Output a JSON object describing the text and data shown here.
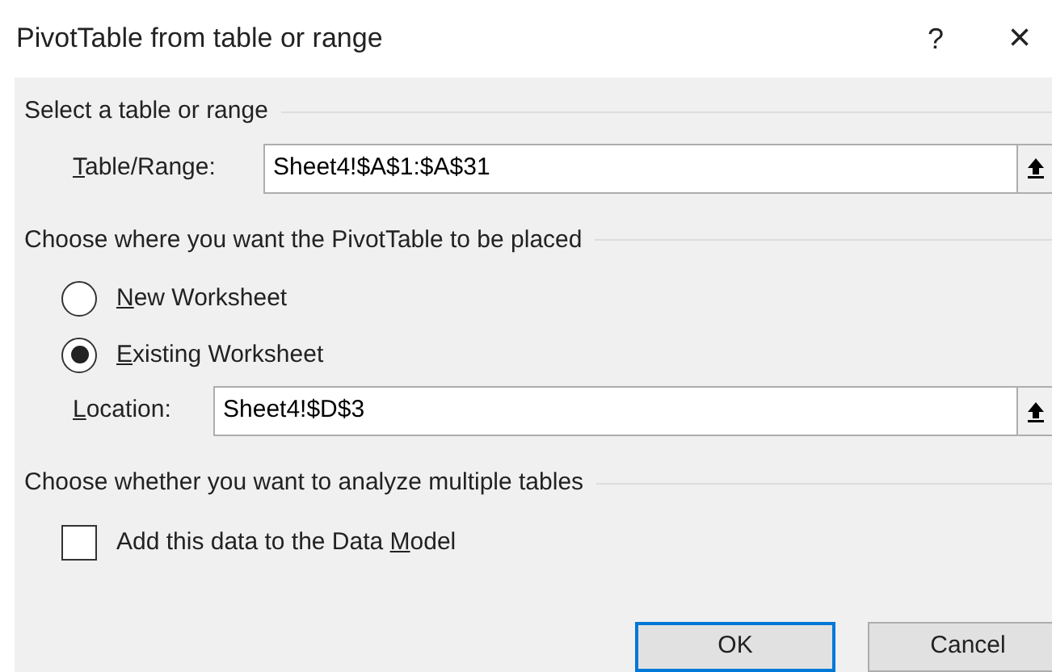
{
  "window": {
    "title": "PivotTable from table or range",
    "help": "?",
    "close": "×"
  },
  "source": {
    "heading": "Select a table or range",
    "field": {
      "label_key": "T",
      "label_after": "able/Range:",
      "value": "Sheet4!$A$1:$A$31"
    }
  },
  "placement": {
    "heading": "Choose where you want the PivotTable to be placed",
    "options": [
      {
        "label_key": "N",
        "label_after": "ew Worksheet",
        "selected": false
      },
      {
        "label_key": "E",
        "label_after": "xisting Worksheet",
        "selected": true
      }
    ],
    "field": {
      "label_key": "L",
      "label_after": "ocation:",
      "value": "Sheet4!$D$3"
    }
  },
  "multiple": {
    "heading": "Choose whether you want to analyze multiple tables",
    "checkbox": {
      "label_before": "Add this data to the Data ",
      "label_key": "M",
      "label_after": "odel",
      "checked": false
    }
  },
  "buttons": [
    {
      "label": "OK",
      "default": true
    },
    {
      "label": "Cancel",
      "default": false
    }
  ]
}
